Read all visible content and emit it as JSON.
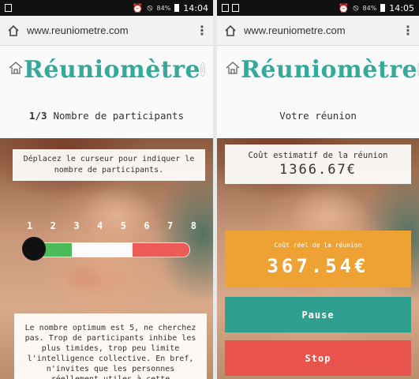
{
  "left": {
    "status": {
      "battery": "84%",
      "time": "14:04"
    },
    "browser": {
      "url": "www.reuniometre.com"
    },
    "app": {
      "logo": "Réuniomètre"
    },
    "step": {
      "number": "1/3",
      "label": "Nombre de participants"
    },
    "instruction": "Déplacez le curseur pour indiquer le nombre de participants.",
    "slider": {
      "numbers": [
        "1",
        "2",
        "3",
        "4",
        "5",
        "6",
        "7",
        "8"
      ],
      "value": 1
    },
    "advice": "Le nombre optimum est 5, ne cherchez pas. Trop de participants inhibe les plus timides, trop peu limite l'intelligence collective. En bref, n'invites que les personnes réellement utiles à cette"
  },
  "right": {
    "status": {
      "battery": "84%",
      "time": "14:05"
    },
    "browser": {
      "url": "www.reuniometre.com"
    },
    "app": {
      "logo": "Réuniomètre"
    },
    "title": "Votre réunion",
    "estimate": {
      "label": "Coût estimatif de la réunion",
      "value": "1366.67€"
    },
    "real": {
      "label": "Coût réel de la réunion",
      "value": "367.54€"
    },
    "pause_label": "Pause",
    "stop_label": "Stop"
  },
  "colors": {
    "brand": "#36a99a",
    "orange": "#eea234",
    "teal": "#2fa08f",
    "red": "#e8534d"
  }
}
